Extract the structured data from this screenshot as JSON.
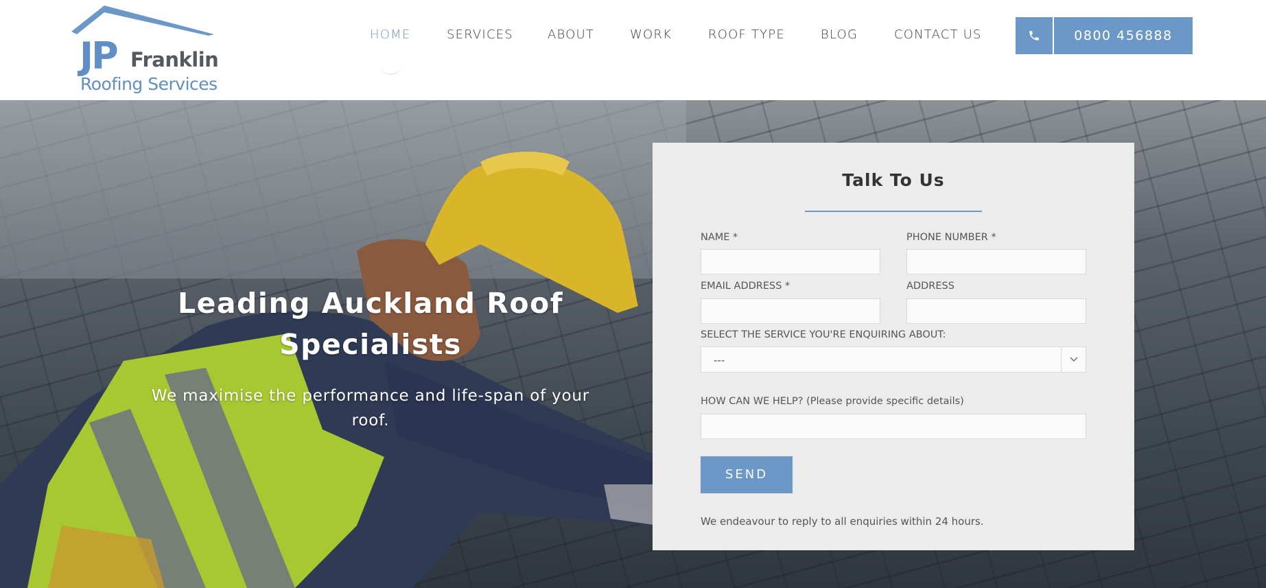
{
  "brand": {
    "logo_primary": "JP",
    "logo_name": "Franklin",
    "logo_sub": "Roofing Services",
    "accent_color": "#6b98c7"
  },
  "nav": {
    "items": [
      {
        "label": "HOME",
        "active": true
      },
      {
        "label": "SERVICES",
        "active": false
      },
      {
        "label": "ABOUT",
        "active": false
      },
      {
        "label": "WORK",
        "active": false
      },
      {
        "label": "ROOF TYPE",
        "active": false
      },
      {
        "label": "BLOG",
        "active": false
      },
      {
        "label": "CONTACT US",
        "active": false
      }
    ],
    "phone": {
      "icon": "phone-icon",
      "number": "0800 456888"
    }
  },
  "hero": {
    "title": "Leading Auckland Roof Specialists",
    "subtitle": "We maximise the performance and life-span of your roof."
  },
  "form": {
    "title": "Talk To Us",
    "fields": {
      "name": {
        "label": "NAME *",
        "value": ""
      },
      "phone": {
        "label": "PHONE NUMBER *",
        "value": ""
      },
      "email": {
        "label": "EMAIL ADDRESS *",
        "value": ""
      },
      "address": {
        "label": "ADDRESS",
        "value": ""
      },
      "service": {
        "label": "SELECT THE SERVICE YOU'RE ENQUIRING ABOUT:",
        "selected": "---"
      },
      "help": {
        "label": "HOW CAN WE HELP? (Please provide specific details)",
        "value": ""
      }
    },
    "send_label": "SEND",
    "note": "We endeavour to reply to all enquiries within 24 hours."
  }
}
